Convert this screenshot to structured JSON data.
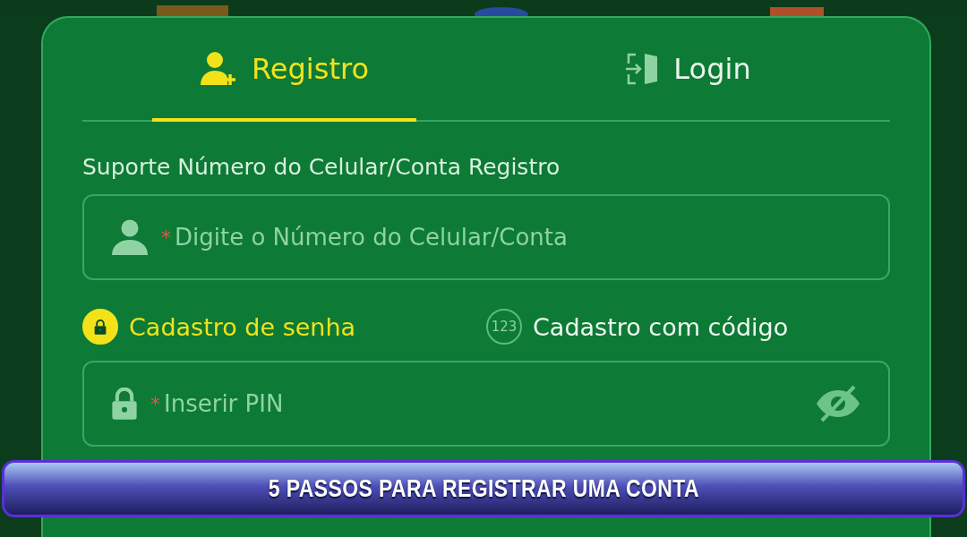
{
  "tabs": [
    {
      "label": "Registro",
      "kind": "register",
      "selected": true
    },
    {
      "label": "Login",
      "kind": "login",
      "selected": false
    }
  ],
  "account_label": "Suporte Número do Celular/Conta Registro",
  "account_field": {
    "required_mark": "*",
    "placeholder": "Digite o Número do Celular/Conta"
  },
  "modes": [
    {
      "label": "Cadastro de senha",
      "kind": "lock",
      "selected": true
    },
    {
      "label": "Cadastro com código",
      "kind": "code",
      "icon_text": "123",
      "selected": false
    }
  ],
  "pin_field": {
    "required_mark": "*",
    "placeholder": "Inserir PIN",
    "password_visible": false
  },
  "banner": {
    "title": "5 PASSOS PARA REGISTRAR UMA CONTA"
  }
}
